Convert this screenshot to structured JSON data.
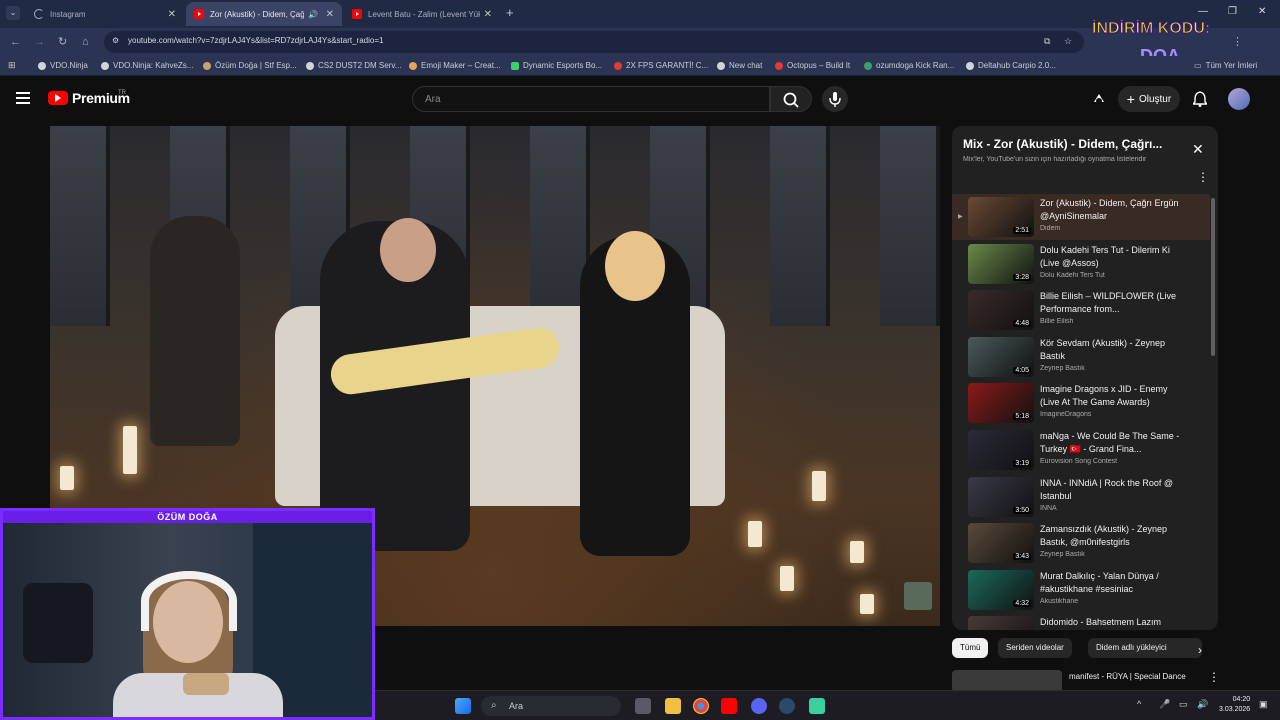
{
  "browser": {
    "tabs": [
      {
        "title": "Instagram",
        "active": false
      },
      {
        "title": "Zor (Akustik) - Didem, Çağrı",
        "active": true
      },
      {
        "title": "Levent Batu - Zalim (Levent Yüks",
        "active": false
      }
    ],
    "url": "youtube.com/watch?v=7zdjrLAJ4Ys&list=RD7zdjrLAJ4Ys&start_radio=1",
    "bookmarks": [
      "VDO.Ninja",
      "VDO.Ninja: KahveZs...",
      "Özüm Doğa | Stf Esp...",
      "CS2 DUST2 DM Serv...",
      "Emoji Maker – Creat...",
      "Dynamic Esports Bo...",
      "2X FPS GARANTİ! C...",
      "New chat",
      "Octopus – Build It",
      "ozumdoga Kick Ran...",
      "Deltahub Carpio 2.0..."
    ],
    "all_bookmarks": "Tüm Yer İmleri",
    "promo_line1": "İNDİRİM KODU:",
    "promo_line2": "DOA"
  },
  "header": {
    "logo_text": "Premium",
    "logo_region": "TR",
    "search_placeholder": "Ara",
    "create_label": "Oluştur"
  },
  "playlist": {
    "title": "Mix - Zor (Akustik) - Didem, Çağrı...",
    "subtitle": "Mix'ler, YouTube'un sizin için hazırladığı oynatma listeleridir",
    "items": [
      {
        "title": "Zor (Akustik) - Didem, Çağrı Ergün @AyniSinemalar",
        "channel": "Didem",
        "duration": "2:51",
        "current": true,
        "color": "#6a4a34"
      },
      {
        "title": "Dolu Kadehi Ters Tut - Dilerim Ki (Live @Assos)",
        "channel": "Dolu Kadehi Ters Tut",
        "duration": "3:28",
        "current": false,
        "color": "#6a8a4a"
      },
      {
        "title": "Billie Eilish – WILDFLOWER (Live Performance from...",
        "channel": "Billie Eilish",
        "duration": "4:48",
        "current": false,
        "color": "#3a2a2a"
      },
      {
        "title": "Kör Sevdam (Akustik) - Zeynep Bastık",
        "channel": "Zeynep Bastık",
        "duration": "4:05",
        "current": false,
        "color": "#4a5a5a"
      },
      {
        "title": "Imagine Dragons x JID - Enemy (Live At The Game Awards)",
        "channel": "ImagineDragons",
        "duration": "5:18",
        "current": false,
        "color": "#8a1a1a"
      },
      {
        "title": "maNga - We Could Be The Same - Turkey 🇹🇷 - Grand Fina...",
        "channel": "Eurovision Song Contest",
        "duration": "3:19",
        "current": false,
        "color": "#2a2a3a"
      },
      {
        "title": "INNA - INNdiA | Rock the Roof @ Istanbul",
        "channel": "INNA",
        "duration": "3:50",
        "current": false,
        "color": "#3a3a4a"
      },
      {
        "title": "Zamansızdık (Akustik) - Zeynep Bastık, @m0nifestgirls",
        "channel": "Zeynep Bastık",
        "duration": "3:43",
        "current": false,
        "color": "#5a4a3a"
      },
      {
        "title": "Murat Dalkılıç - Yalan Dünya / #akustikhane #sesiniac",
        "channel": "Akustikhane",
        "duration": "4:32",
        "current": false,
        "color": "#1a6a5a"
      },
      {
        "title": "Didomido - Bahsetmem Lazım",
        "channel": "",
        "duration": "",
        "current": false,
        "color": "#4a3a3a"
      }
    ]
  },
  "chips": {
    "all": "Tümü",
    "series": "Seriden videolar",
    "uploads": "Didem adlı yükleyici"
  },
  "recommendation": {
    "title": "manifest - RÜYA | Special Dance"
  },
  "webcam": {
    "label": "ÖZÜM DOĞA"
  },
  "taskbar": {
    "search": "Ara",
    "time": "04:20",
    "date": "3.03.2026"
  },
  "colors": {
    "accent_red": "#ff0000",
    "webcam_border": "#7b2cff",
    "panel_bg": "#212121"
  }
}
